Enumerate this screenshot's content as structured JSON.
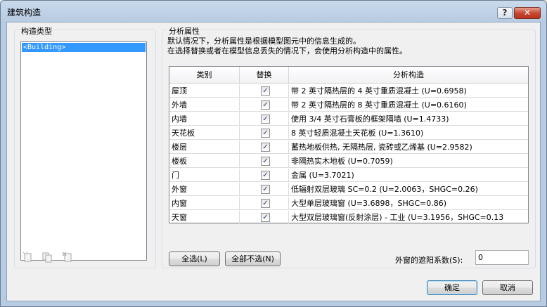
{
  "window": {
    "title": "建筑构造",
    "help_label": "?",
    "close_label": "✕"
  },
  "left": {
    "group_label": "构造类型",
    "items": [
      "<Building>"
    ],
    "icons": [
      "new-icon",
      "duplicate-icon",
      "delete-icon"
    ]
  },
  "right": {
    "group_label": "分析属性",
    "desc_line1": "默认情况下，分析属性是根据模型图元中的信息生成的。",
    "desc_line2": "在选择替换或者在模型信息丢失的情况下，会使用分析构造中的属性。",
    "headers": [
      "类别",
      "替换",
      "分析构造"
    ],
    "rows": [
      {
        "category": "屋顶",
        "override": true,
        "construction": "带 2 英寸隔热层的 4 英寸重质混凝土 (U=0.6958)"
      },
      {
        "category": "外墙",
        "override": true,
        "construction": "带 2 英寸隔热层的 8 英寸重质混凝土 (U=0.6160)"
      },
      {
        "category": "内墙",
        "override": true,
        "construction": "使用 3/4 英寸石膏板的框架隔墙 (U=1.4733)"
      },
      {
        "category": "天花板",
        "override": true,
        "construction": "8 英寸轻质混凝土天花板 (U=1.3610)"
      },
      {
        "category": "楼层",
        "override": true,
        "construction": "蓄热地板供热, 无隔热层, 瓷砖或乙烯基 (U=2.9582)"
      },
      {
        "category": "楼板",
        "override": true,
        "construction": "非隔热实木地板 (U=0.7059)"
      },
      {
        "category": "门",
        "override": true,
        "construction": "金属 (U=3.7021)"
      },
      {
        "category": "外窗",
        "override": true,
        "construction": "低辐射双层玻璃 SC=0.2 (U=2.0063，SHGC=0.26)"
      },
      {
        "category": "内窗",
        "override": true,
        "construction": "大型单层玻璃窗 (U=3.6898，SHGC=0.86)"
      },
      {
        "category": "天窗",
        "override": true,
        "construction": "大型双层玻璃窗(反射涂层) - 工业 (U=3.1956，SHGC=0.13"
      }
    ],
    "select_all_label": "全选(L)",
    "deselect_all_label": "全部不选(N)",
    "shading_label": "外窗的遮阳系数(S):",
    "shading_value": "0"
  },
  "footer": {
    "ok_label": "确定",
    "cancel_label": "取消"
  }
}
